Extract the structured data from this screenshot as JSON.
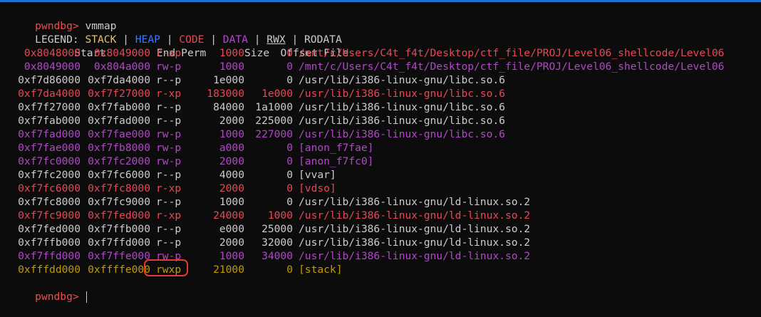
{
  "prompt": {
    "text": "pwndbg>",
    "color": "#f14c4c"
  },
  "command": " vmmap",
  "legend": {
    "label": "LEGEND: ",
    "sep": " | ",
    "items": [
      {
        "text": "STACK",
        "color": "#e5c07b",
        "underline": false
      },
      {
        "text": "HEAP",
        "color": "#3b78ff",
        "underline": false
      },
      {
        "text": "CODE",
        "color": "#e74856",
        "underline": false
      },
      {
        "text": "DATA",
        "color": "#b148c6",
        "underline": false
      },
      {
        "text": "RWX",
        "color": "#cccccc",
        "underline": true
      },
      {
        "text": "RODATA",
        "color": "#cccccc",
        "underline": false
      }
    ]
  },
  "header": {
    "start": "Start",
    "end": "End",
    "perm": "Perm",
    "size": "Size",
    "offset": "Offset",
    "file": "File"
  },
  "colors": {
    "default": "#cccccc",
    "code": "#e74856",
    "data": "#b148c6",
    "stack": "#c19c00",
    "annotation": "#e53935"
  },
  "rows": [
    {
      "start": "0x8048000",
      "end": "0x8049000",
      "perm": "r-xp",
      "size": "1000",
      "offset": "0",
      "file": "/mnt/c/Users/C4t_f4t/Desktop/ctf_file/PROJ/Level06_shellcode/Level06",
      "color": "code",
      "underline": false
    },
    {
      "start": "0x8049000",
      "end": "0x804a000",
      "perm": "rw-p",
      "size": "1000",
      "offset": "0",
      "file": "/mnt/c/Users/C4t_f4t/Desktop/ctf_file/PROJ/Level06_shellcode/Level06",
      "color": "data",
      "underline": false
    },
    {
      "start": "0xf7d86000",
      "end": "0xf7da4000",
      "perm": "r--p",
      "size": "1e000",
      "offset": "0",
      "file": "/usr/lib/i386-linux-gnu/libc.so.6",
      "color": "default",
      "underline": false
    },
    {
      "start": "0xf7da4000",
      "end": "0xf7f27000",
      "perm": "r-xp",
      "size": "183000",
      "offset": "1e000",
      "file": "/usr/lib/i386-linux-gnu/libc.so.6",
      "color": "code",
      "underline": false
    },
    {
      "start": "0xf7f27000",
      "end": "0xf7fab000",
      "perm": "r--p",
      "size": "84000",
      "offset": "1a1000",
      "file": "/usr/lib/i386-linux-gnu/libc.so.6",
      "color": "default",
      "underline": false
    },
    {
      "start": "0xf7fab000",
      "end": "0xf7fad000",
      "perm": "r--p",
      "size": "2000",
      "offset": "225000",
      "file": "/usr/lib/i386-linux-gnu/libc.so.6",
      "color": "default",
      "underline": false
    },
    {
      "start": "0xf7fad000",
      "end": "0xf7fae000",
      "perm": "rw-p",
      "size": "1000",
      "offset": "227000",
      "file": "/usr/lib/i386-linux-gnu/libc.so.6",
      "color": "data",
      "underline": false
    },
    {
      "start": "0xf7fae000",
      "end": "0xf7fb8000",
      "perm": "rw-p",
      "size": "a000",
      "offset": "0",
      "file": "[anon_f7fae]",
      "color": "data",
      "underline": false
    },
    {
      "start": "0xf7fc0000",
      "end": "0xf7fc2000",
      "perm": "rw-p",
      "size": "2000",
      "offset": "0",
      "file": "[anon_f7fc0]",
      "color": "data",
      "underline": false
    },
    {
      "start": "0xf7fc2000",
      "end": "0xf7fc6000",
      "perm": "r--p",
      "size": "4000",
      "offset": "0",
      "file": "[vvar]",
      "color": "default",
      "underline": false
    },
    {
      "start": "0xf7fc6000",
      "end": "0xf7fc8000",
      "perm": "r-xp",
      "size": "2000",
      "offset": "0",
      "file": "[vdso]",
      "color": "code",
      "underline": false
    },
    {
      "start": "0xf7fc8000",
      "end": "0xf7fc9000",
      "perm": "r--p",
      "size": "1000",
      "offset": "0",
      "file": "/usr/lib/i386-linux-gnu/ld-linux.so.2",
      "color": "default",
      "underline": false
    },
    {
      "start": "0xf7fc9000",
      "end": "0xf7fed000",
      "perm": "r-xp",
      "size": "24000",
      "offset": "1000",
      "file": "/usr/lib/i386-linux-gnu/ld-linux.so.2",
      "color": "code",
      "underline": false
    },
    {
      "start": "0xf7fed000",
      "end": "0xf7ffb000",
      "perm": "r--p",
      "size": "e000",
      "offset": "25000",
      "file": "/usr/lib/i386-linux-gnu/ld-linux.so.2",
      "color": "default",
      "underline": false
    },
    {
      "start": "0xf7ffb000",
      "end": "0xf7ffd000",
      "perm": "r--p",
      "size": "2000",
      "offset": "32000",
      "file": "/usr/lib/i386-linux-gnu/ld-linux.so.2",
      "color": "default",
      "underline": false
    },
    {
      "start": "0xf7ffd000",
      "end": "0xf7ffe000",
      "perm": "rw-p",
      "size": "1000",
      "offset": "34000",
      "file": "/usr/lib/i386-linux-gnu/ld-linux.so.2",
      "color": "data",
      "underline": false
    },
    {
      "start": "0xfffdd000",
      "end": "0xffffe000",
      "perm": "rwxp",
      "size": "21000",
      "offset": "0",
      "file": "[stack]",
      "color": "stack",
      "underline": true
    }
  ]
}
